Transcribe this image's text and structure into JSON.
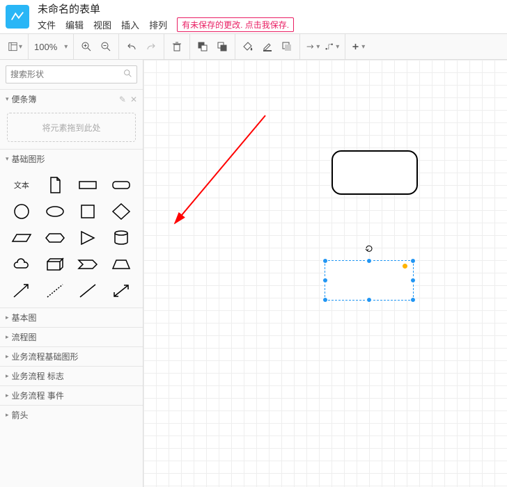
{
  "doc_title": "未命名的表单",
  "menu": {
    "file": "文件",
    "edit": "编辑",
    "view": "视图",
    "insert": "插入",
    "arrange": "排列"
  },
  "save_notice": "有未保存的更改. 点击我保存.",
  "toolbar": {
    "zoom": "100%"
  },
  "search": {
    "placeholder": "搜索形状"
  },
  "scratchpad": {
    "title": "便条簿",
    "dropzone": "将元素拖到此处"
  },
  "panels": {
    "basic_shapes": "基础图形",
    "text_label": "文本",
    "basic_diagram": "基本图",
    "flowchart": "流程图",
    "bp_basic": "业务流程基础图形",
    "bp_mark": "业务流程 标志",
    "bp_event": "业务流程 事件",
    "arrows": "箭头"
  }
}
